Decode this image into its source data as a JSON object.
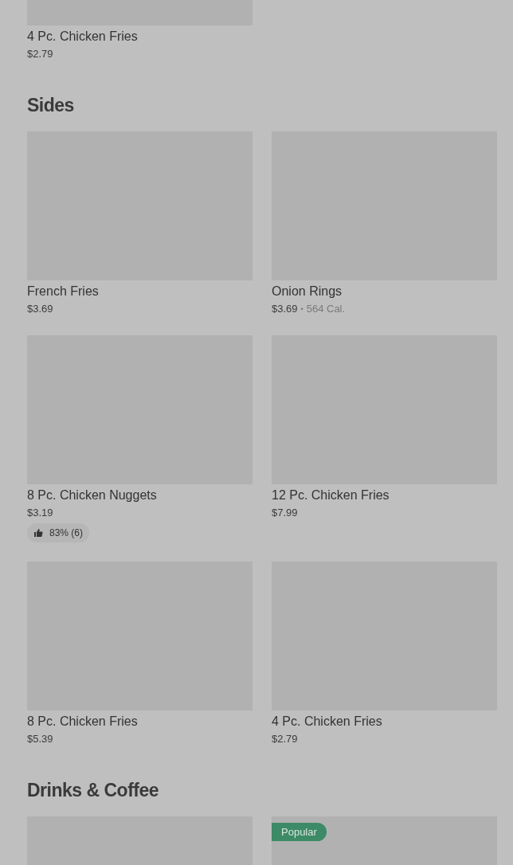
{
  "sections": [
    {
      "items": [
        {
          "kind": "picture",
          "name": "4 Pc. Chicken Fries",
          "price": "$2.79"
        }
      ]
    },
    {
      "heading": "Sides",
      "items": [
        {
          "kind": "picture",
          "name": "French Fries",
          "price": "$3.69"
        },
        {
          "kind": "picture",
          "name": "Onion Rings",
          "price": "$3.69",
          "separator": "•",
          "calories": "564 Cal."
        },
        {
          "kind": "picture",
          "name": "8 Pc. Chicken Nuggets",
          "price": "$3.19",
          "rating": "83% (6)"
        },
        {
          "kind": "picture",
          "name": "12 Pc. Chicken Fries",
          "price": "$7.99"
        },
        {
          "kind": "picture",
          "name": "8 Pc. Chicken Fries",
          "price": "$5.39"
        },
        {
          "kind": "picture",
          "name": "4 Pc. Chicken Fries",
          "price": "$2.79"
        }
      ]
    },
    {
      "heading": "Drinks & Coffee",
      "items": [
        {
          "kind": "picture"
        },
        {
          "kind": "picture",
          "badge": "Popular"
        }
      ]
    }
  ]
}
